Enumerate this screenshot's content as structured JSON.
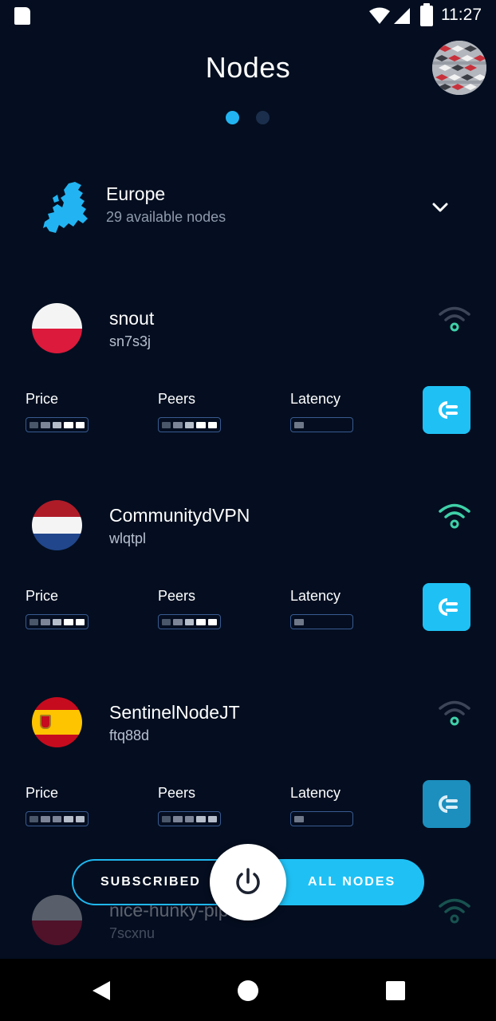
{
  "status_bar": {
    "time": "11:27"
  },
  "header": {
    "title": "Nodes",
    "page_count": 2,
    "active_page": 1
  },
  "region": {
    "name": "Europe",
    "subtitle": "29 available nodes"
  },
  "metric_labels": {
    "price": "Price",
    "peers": "Peers",
    "latency": "Latency"
  },
  "nodes": [
    {
      "name": "snout",
      "id": "sn7s3j",
      "country_flag": "poland",
      "signal": "low",
      "price_level": 4,
      "peers_level": 4,
      "latency_level": 1
    },
    {
      "name": "CommunitydVPN",
      "id": "wlqtpl",
      "country_flag": "netherlands",
      "signal": "full",
      "price_level": 4,
      "peers_level": 4,
      "latency_level": 1
    },
    {
      "name": "SentinelNodeJT",
      "id": "ftq88d",
      "country_flag": "spain",
      "signal": "low",
      "price_level": 4,
      "peers_level": 4,
      "latency_level": 1
    },
    {
      "name": "nice-hunky-pip",
      "id": "7scxnu",
      "country_flag": "poland",
      "signal": "full"
    }
  ],
  "toggle": {
    "left_label": "SUBSCRIBED",
    "right_label": "ALL NODES",
    "selected": "ALL NODES"
  },
  "colors": {
    "accent": "#1fc1f5",
    "background": "#040e20",
    "signal_green": "#3fd0a8"
  },
  "icons": [
    "sd-card-icon",
    "wifi-icon",
    "cellular-icon",
    "battery-icon",
    "europe-map-icon",
    "chevron-down-icon",
    "wifi-signal-icon",
    "plug-icon",
    "power-icon"
  ]
}
